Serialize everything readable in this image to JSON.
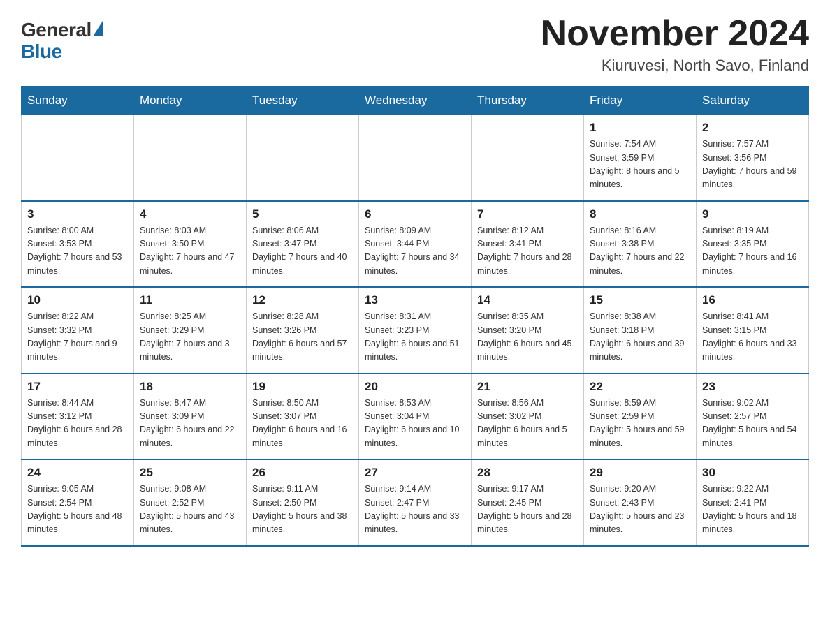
{
  "header": {
    "logo_general": "General",
    "logo_blue": "Blue",
    "title": "November 2024",
    "subtitle": "Kiuruvesi, North Savo, Finland"
  },
  "days_of_week": [
    "Sunday",
    "Monday",
    "Tuesday",
    "Wednesday",
    "Thursday",
    "Friday",
    "Saturday"
  ],
  "weeks": [
    [
      {
        "day": "",
        "info": ""
      },
      {
        "day": "",
        "info": ""
      },
      {
        "day": "",
        "info": ""
      },
      {
        "day": "",
        "info": ""
      },
      {
        "day": "",
        "info": ""
      },
      {
        "day": "1",
        "info": "Sunrise: 7:54 AM\nSunset: 3:59 PM\nDaylight: 8 hours and 5 minutes."
      },
      {
        "day": "2",
        "info": "Sunrise: 7:57 AM\nSunset: 3:56 PM\nDaylight: 7 hours and 59 minutes."
      }
    ],
    [
      {
        "day": "3",
        "info": "Sunrise: 8:00 AM\nSunset: 3:53 PM\nDaylight: 7 hours and 53 minutes."
      },
      {
        "day": "4",
        "info": "Sunrise: 8:03 AM\nSunset: 3:50 PM\nDaylight: 7 hours and 47 minutes."
      },
      {
        "day": "5",
        "info": "Sunrise: 8:06 AM\nSunset: 3:47 PM\nDaylight: 7 hours and 40 minutes."
      },
      {
        "day": "6",
        "info": "Sunrise: 8:09 AM\nSunset: 3:44 PM\nDaylight: 7 hours and 34 minutes."
      },
      {
        "day": "7",
        "info": "Sunrise: 8:12 AM\nSunset: 3:41 PM\nDaylight: 7 hours and 28 minutes."
      },
      {
        "day": "8",
        "info": "Sunrise: 8:16 AM\nSunset: 3:38 PM\nDaylight: 7 hours and 22 minutes."
      },
      {
        "day": "9",
        "info": "Sunrise: 8:19 AM\nSunset: 3:35 PM\nDaylight: 7 hours and 16 minutes."
      }
    ],
    [
      {
        "day": "10",
        "info": "Sunrise: 8:22 AM\nSunset: 3:32 PM\nDaylight: 7 hours and 9 minutes."
      },
      {
        "day": "11",
        "info": "Sunrise: 8:25 AM\nSunset: 3:29 PM\nDaylight: 7 hours and 3 minutes."
      },
      {
        "day": "12",
        "info": "Sunrise: 8:28 AM\nSunset: 3:26 PM\nDaylight: 6 hours and 57 minutes."
      },
      {
        "day": "13",
        "info": "Sunrise: 8:31 AM\nSunset: 3:23 PM\nDaylight: 6 hours and 51 minutes."
      },
      {
        "day": "14",
        "info": "Sunrise: 8:35 AM\nSunset: 3:20 PM\nDaylight: 6 hours and 45 minutes."
      },
      {
        "day": "15",
        "info": "Sunrise: 8:38 AM\nSunset: 3:18 PM\nDaylight: 6 hours and 39 minutes."
      },
      {
        "day": "16",
        "info": "Sunrise: 8:41 AM\nSunset: 3:15 PM\nDaylight: 6 hours and 33 minutes."
      }
    ],
    [
      {
        "day": "17",
        "info": "Sunrise: 8:44 AM\nSunset: 3:12 PM\nDaylight: 6 hours and 28 minutes."
      },
      {
        "day": "18",
        "info": "Sunrise: 8:47 AM\nSunset: 3:09 PM\nDaylight: 6 hours and 22 minutes."
      },
      {
        "day": "19",
        "info": "Sunrise: 8:50 AM\nSunset: 3:07 PM\nDaylight: 6 hours and 16 minutes."
      },
      {
        "day": "20",
        "info": "Sunrise: 8:53 AM\nSunset: 3:04 PM\nDaylight: 6 hours and 10 minutes."
      },
      {
        "day": "21",
        "info": "Sunrise: 8:56 AM\nSunset: 3:02 PM\nDaylight: 6 hours and 5 minutes."
      },
      {
        "day": "22",
        "info": "Sunrise: 8:59 AM\nSunset: 2:59 PM\nDaylight: 5 hours and 59 minutes."
      },
      {
        "day": "23",
        "info": "Sunrise: 9:02 AM\nSunset: 2:57 PM\nDaylight: 5 hours and 54 minutes."
      }
    ],
    [
      {
        "day": "24",
        "info": "Sunrise: 9:05 AM\nSunset: 2:54 PM\nDaylight: 5 hours and 48 minutes."
      },
      {
        "day": "25",
        "info": "Sunrise: 9:08 AM\nSunset: 2:52 PM\nDaylight: 5 hours and 43 minutes."
      },
      {
        "day": "26",
        "info": "Sunrise: 9:11 AM\nSunset: 2:50 PM\nDaylight: 5 hours and 38 minutes."
      },
      {
        "day": "27",
        "info": "Sunrise: 9:14 AM\nSunset: 2:47 PM\nDaylight: 5 hours and 33 minutes."
      },
      {
        "day": "28",
        "info": "Sunrise: 9:17 AM\nSunset: 2:45 PM\nDaylight: 5 hours and 28 minutes."
      },
      {
        "day": "29",
        "info": "Sunrise: 9:20 AM\nSunset: 2:43 PM\nDaylight: 5 hours and 23 minutes."
      },
      {
        "day": "30",
        "info": "Sunrise: 9:22 AM\nSunset: 2:41 PM\nDaylight: 5 hours and 18 minutes."
      }
    ]
  ]
}
